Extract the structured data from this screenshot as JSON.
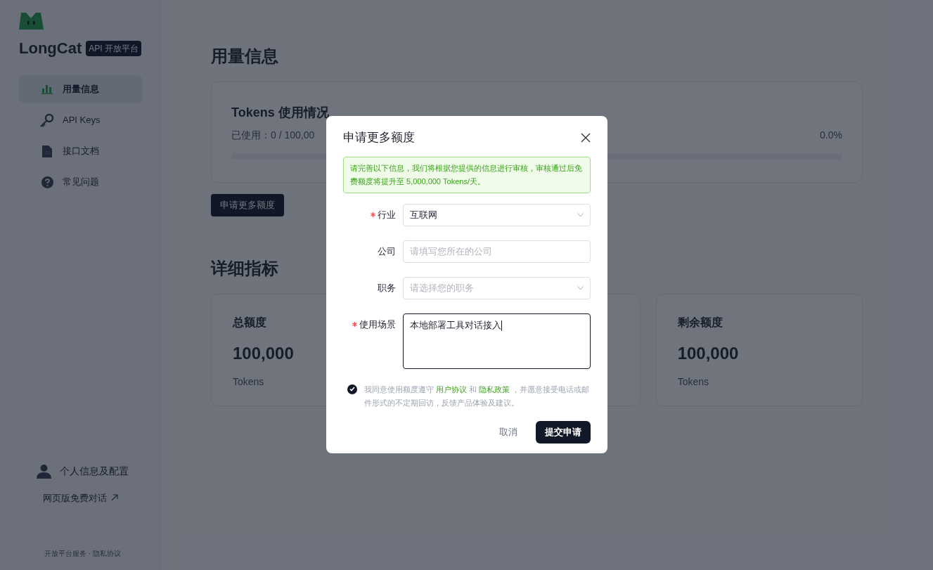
{
  "brand": {
    "name": "LongCat",
    "badge": "API 开放平台"
  },
  "sidebar": {
    "items": [
      {
        "label": "用量信息",
        "selected": true
      },
      {
        "label": "API Keys",
        "selected": false
      },
      {
        "label": "接口文档",
        "selected": false
      },
      {
        "label": "常见问题",
        "selected": false
      }
    ],
    "profile": "个人信息及配置",
    "web_chat": "网页版免费对话",
    "footer": "开放平台服务 · 隐私协议"
  },
  "main": {
    "title": "用量信息",
    "usage_card": {
      "title": "Tokens 使用情况",
      "used": "已使用：0 / 100,00",
      "percent": "0.0%",
      "level": 0
    },
    "apply_button": "申请更多额度",
    "details_title": "详细指标",
    "stats": [
      {
        "label": "总额度",
        "value": "100,000",
        "unit": "Tokens"
      },
      {
        "label": "剩余额度",
        "value": "100,000",
        "unit": "Tokens"
      }
    ]
  },
  "dialog": {
    "title": "申请更多额度",
    "notice": "请完善以下信息，我们将根据您提供的信息进行审核，审核通过后免费额度将提升至 5,000,000 Tokens/天。",
    "fields": [
      {
        "kind": "select",
        "label": "行业",
        "required": true,
        "value": "互联网"
      },
      {
        "kind": "input",
        "label": "公司",
        "required": false,
        "placeholder": "请填写您所在的公司"
      },
      {
        "kind": "select",
        "label": "职务",
        "required": false,
        "placeholder": "请选择您的职务"
      },
      {
        "kind": "textarea",
        "label": "使用场景",
        "required": true,
        "value": "本地部署工具对话接入",
        "focused": true
      }
    ],
    "agreement": {
      "checked": true,
      "parts": [
        {
          "kind": "text",
          "text": "我同意使用额度遵守 "
        },
        {
          "kind": "link",
          "text": "用户协议"
        },
        {
          "kind": "text",
          "text": " 和 "
        },
        {
          "kind": "link",
          "text": "隐私政策"
        },
        {
          "kind": "text",
          "text": " ，并愿意接受电话或邮件形式的不定期回访，反馈产品体验及建议。"
        }
      ]
    },
    "cancel": "取消",
    "submit": "提交申请"
  }
}
